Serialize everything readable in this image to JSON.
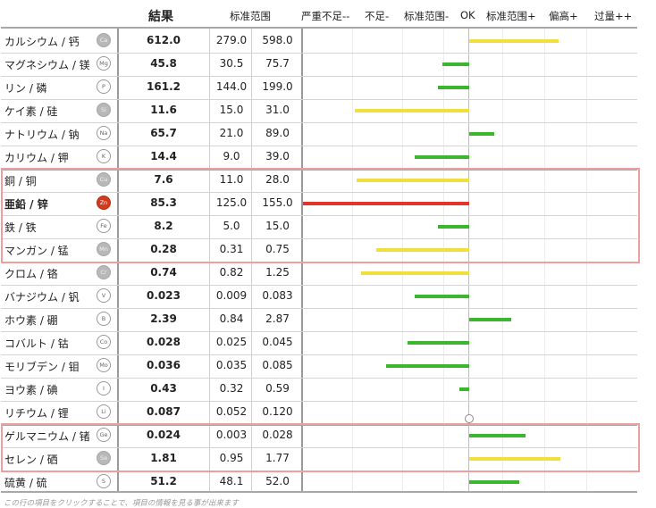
{
  "header": {
    "result": "結果",
    "standard_range": "标准范围",
    "scale_labels": [
      "严重不足--",
      "不足-",
      "标准范围-",
      "OK",
      "标准范围+",
      "偏高+",
      "过量++"
    ]
  },
  "colors": {
    "green": "#3cb52f",
    "yellow": "#f0df3c",
    "red": "#e2342a",
    "group_box": "#ef9e9e"
  },
  "rows": [
    {
      "name": "カルシウム / 钙",
      "symbol": "Ca",
      "value": "612.0",
      "low": "279.0",
      "high": "598.0",
      "status": "标准范围+",
      "bar_color": "yellow",
      "bar_start": 0,
      "bar_end": 0.54,
      "bold_name": false,
      "badge": "gray"
    },
    {
      "name": "マグネシウム / 镁",
      "symbol": "Mg",
      "value": "45.8",
      "low": "30.5",
      "high": "75.7",
      "status": "标准范围-",
      "bar_color": "green",
      "bar_start": -0.16,
      "bar_end": 0,
      "bold_name": false,
      "badge": "outline"
    },
    {
      "name": "リン / 磷",
      "symbol": "P",
      "value": "161.2",
      "low": "144.0",
      "high": "199.0",
      "status": "标准范围-",
      "bar_color": "green",
      "bar_start": -0.19,
      "bar_end": 0,
      "bold_name": false,
      "badge": "outline"
    },
    {
      "name": "ケイ素 / 硅",
      "symbol": "Si",
      "value": "11.6",
      "low": "15.0",
      "high": "31.0",
      "status": "不足-",
      "bar_color": "yellow",
      "bar_start": -0.69,
      "bar_end": 0,
      "bold_name": false,
      "badge": "gray"
    },
    {
      "name": "ナトリウム / 钠",
      "symbol": "Na",
      "value": "65.7",
      "low": "21.0",
      "high": "89.0",
      "status": "标准范围+",
      "bar_color": "green",
      "bar_start": 0,
      "bar_end": 0.15,
      "bold_name": false,
      "badge": "outline"
    },
    {
      "name": "カリウム / 钾",
      "symbol": "K",
      "value": "14.4",
      "low": "9.0",
      "high": "39.0",
      "status": "标准范围-",
      "bar_color": "green",
      "bar_start": -0.33,
      "bar_end": 0,
      "bold_name": false,
      "badge": "outline"
    },
    {
      "name": "銅 / 铜",
      "symbol": "Cu",
      "value": "7.6",
      "low": "11.0",
      "high": "28.0",
      "status": "不足-",
      "bar_color": "yellow",
      "bar_start": -0.68,
      "bar_end": 0,
      "bold_name": false,
      "badge": "gray"
    },
    {
      "name": "亜鉛 / 锌",
      "symbol": "Zn",
      "value": "85.3",
      "low": "125.0",
      "high": "155.0",
      "status": "严重不足--",
      "bar_color": "red",
      "bar_start": -1.0,
      "bar_end": 0,
      "bold_name": true,
      "badge": "red"
    },
    {
      "name": "鉄 / 铁",
      "symbol": "Fe",
      "value": "8.2",
      "low": "5.0",
      "high": "15.0",
      "status": "标准范围-",
      "bar_color": "green",
      "bar_start": -0.19,
      "bar_end": 0,
      "bold_name": false,
      "badge": "outline"
    },
    {
      "name": "マンガン / 锰",
      "symbol": "Mn",
      "value": "0.28",
      "low": "0.31",
      "high": "0.75",
      "status": "不足-",
      "bar_color": "yellow",
      "bar_start": -0.56,
      "bar_end": 0,
      "bold_name": false,
      "badge": "gray"
    },
    {
      "name": "クロム / 铬",
      "symbol": "Cr",
      "value": "0.74",
      "low": "0.82",
      "high": "1.25",
      "status": "不足-",
      "bar_color": "yellow",
      "bar_start": -0.65,
      "bar_end": 0,
      "bold_name": false,
      "badge": "gray"
    },
    {
      "name": "バナジウム / 钒",
      "symbol": "V",
      "value": "0.023",
      "low": "0.009",
      "high": "0.083",
      "status": "标准范围-",
      "bar_color": "green",
      "bar_start": -0.33,
      "bar_end": 0,
      "bold_name": false,
      "badge": "outline"
    },
    {
      "name": "ホウ素 / 硼",
      "symbol": "B",
      "value": "2.39",
      "low": "0.84",
      "high": "2.87",
      "status": "标准范围+",
      "bar_color": "green",
      "bar_start": 0,
      "bar_end": 0.25,
      "bold_name": false,
      "badge": "outline"
    },
    {
      "name": "コバルト / 钴",
      "symbol": "Co",
      "value": "0.028",
      "low": "0.025",
      "high": "0.045",
      "status": "标准范围-",
      "bar_color": "green",
      "bar_start": -0.37,
      "bar_end": 0,
      "bold_name": false,
      "badge": "outline"
    },
    {
      "name": "モリブデン / 钼",
      "symbol": "Mo",
      "value": "0.036",
      "low": "0.035",
      "high": "0.085",
      "status": "标准范围-",
      "bar_color": "green",
      "bar_start": -0.5,
      "bar_end": 0,
      "bold_name": false,
      "badge": "outline"
    },
    {
      "name": "ヨウ素 / 碘",
      "symbol": "I",
      "value": "0.43",
      "low": "0.32",
      "high": "0.59",
      "status": "标准范围-",
      "bar_color": "green",
      "bar_start": -0.06,
      "bar_end": 0,
      "bold_name": false,
      "badge": "outline"
    },
    {
      "name": "リチウム / 锂",
      "symbol": "Li",
      "value": "0.087",
      "low": "0.052",
      "high": "0.120",
      "status": "OK",
      "bar_color": "circle",
      "bar_start": 0,
      "bar_end": 0,
      "bold_name": false,
      "badge": "outline"
    },
    {
      "name": "ゲルマニウム / 锗",
      "symbol": "Ge",
      "value": "0.024",
      "low": "0.003",
      "high": "0.028",
      "status": "标准范围+",
      "bar_color": "green",
      "bar_start": 0,
      "bar_end": 0.34,
      "bold_name": false,
      "badge": "outline"
    },
    {
      "name": "セレン / 硒",
      "symbol": "Se",
      "value": "1.81",
      "low": "0.95",
      "high": "1.77",
      "status": "标准范围+",
      "bar_color": "yellow",
      "bar_start": 0,
      "bar_end": 0.55,
      "bold_name": false,
      "badge": "gray"
    },
    {
      "name": "硫黄 / 硫",
      "symbol": "S",
      "value": "51.2",
      "low": "48.1",
      "high": "52.0",
      "status": "标准范围+",
      "bar_color": "green",
      "bar_start": 0,
      "bar_end": 0.3,
      "bold_name": false,
      "badge": "outline"
    }
  ],
  "footnote": "この行の項目をクリックすることで、項目の情報を見る事が出来ます"
}
